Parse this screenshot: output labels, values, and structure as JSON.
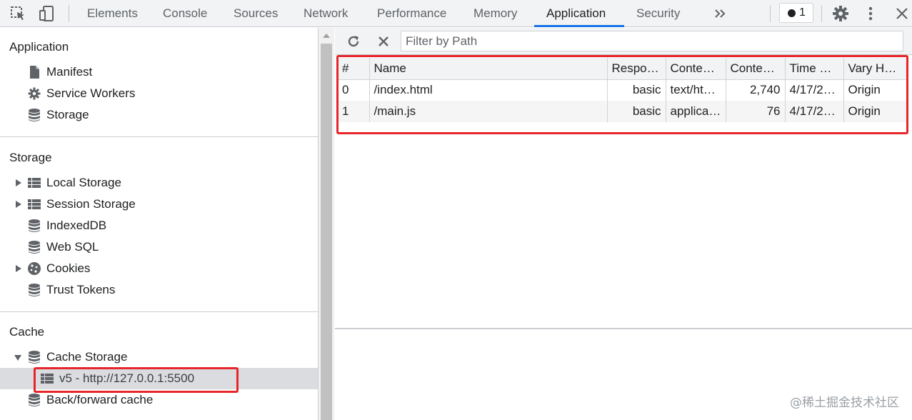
{
  "toolbar": {
    "tabs": [
      "Elements",
      "Console",
      "Sources",
      "Network",
      "Performance",
      "Memory",
      "Application",
      "Security"
    ],
    "active_tab": "Application",
    "more_icon": "chevrons-right-icon",
    "issues_count": "1",
    "accent_color": "#1a73e8"
  },
  "sidebar": {
    "application": {
      "title": "Application",
      "items": [
        {
          "label": "Manifest",
          "icon": "file-icon"
        },
        {
          "label": "Service Workers",
          "icon": "gear-icon"
        },
        {
          "label": "Storage",
          "icon": "database-icon"
        }
      ]
    },
    "storage": {
      "title": "Storage",
      "items": [
        {
          "label": "Local Storage",
          "icon": "grid-icon",
          "expandable": true
        },
        {
          "label": "Session Storage",
          "icon": "grid-icon",
          "expandable": true
        },
        {
          "label": "IndexedDB",
          "icon": "database-icon"
        },
        {
          "label": "Web SQL",
          "icon": "database-icon"
        },
        {
          "label": "Cookies",
          "icon": "cookie-icon",
          "expandable": true
        },
        {
          "label": "Trust Tokens",
          "icon": "database-icon"
        }
      ]
    },
    "cache": {
      "title": "Cache",
      "items": [
        {
          "label": "Cache Storage",
          "icon": "database-icon",
          "expanded": true
        },
        {
          "label": "v5 - http://127.0.0.1:5500",
          "icon": "grid-icon",
          "selected": true
        },
        {
          "label": "Back/forward cache",
          "icon": "database-icon"
        }
      ]
    }
  },
  "main": {
    "filter_placeholder": "Filter by Path",
    "columns": [
      "#",
      "Name",
      "Respo…",
      "Conte…",
      "Conte…",
      "Time C…",
      "Vary H…"
    ],
    "rows": [
      [
        "0",
        "/index.html",
        "basic",
        "text/ht…",
        "2,740",
        "4/17/2…",
        "Origin"
      ],
      [
        "1",
        "/main.js",
        "basic",
        "applica…",
        "76",
        "4/17/2…",
        "Origin"
      ]
    ]
  },
  "watermark": "@稀土掘金技术社区",
  "highlight_color": "#e8252a"
}
